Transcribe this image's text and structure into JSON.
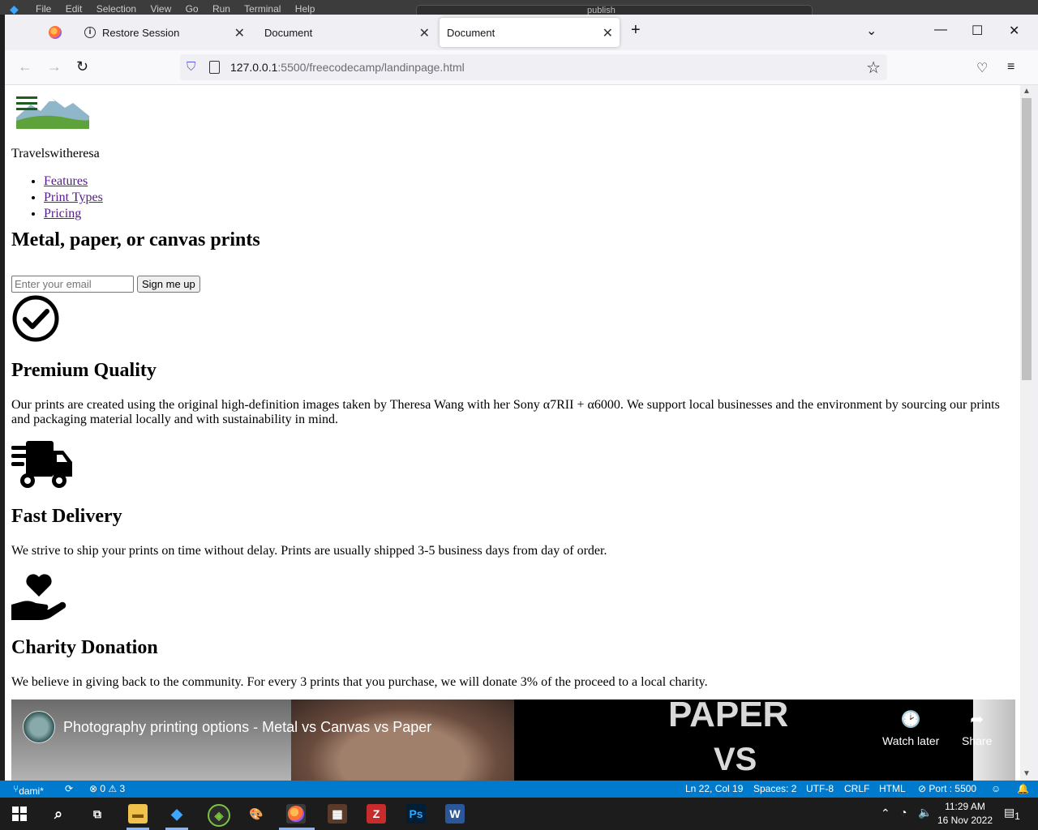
{
  "vscode": {
    "menu": [
      "File",
      "Edit",
      "Selection",
      "View",
      "Go",
      "Run",
      "Terminal",
      "Help"
    ],
    "command_center": "publish"
  },
  "browser": {
    "tabs": [
      {
        "label": "Restore Session",
        "active": false
      },
      {
        "label": "Document",
        "active": false
      },
      {
        "label": "Document",
        "active": true
      }
    ],
    "new_tab": "+",
    "url_host": "127.0.0.1",
    "url_rest": ":5500/freecodecamp/landinpage.html"
  },
  "page": {
    "brand": "Travelswitheresa",
    "nav": [
      "Features",
      "Print Types",
      "Pricing"
    ],
    "hero_title": "Metal, paper, or canvas prints",
    "email_placeholder": "Enter your email",
    "signup_label": "Sign me up",
    "features": [
      {
        "icon": "check-circle-icon",
        "title": "Premium Quality",
        "text": "Our prints are created using the original high-definition images taken by Theresa Wang with her Sony α7RII + α6000. We support local businesses and the environment by sourcing our prints and packaging material locally and with sustainability in mind."
      },
      {
        "icon": "truck-icon",
        "title": "Fast Delivery",
        "text": "We strive to ship your prints on time without delay. Prints are usually shipped 3-5 business days from day of order."
      },
      {
        "icon": "hand-heart-icon",
        "title": "Charity Donation",
        "text": "We believe in giving back to the community. For every 3 prints that you purchase, we will donate 3% of the proceed to a local charity."
      }
    ],
    "video": {
      "title": "Photography printing options - Metal vs Canvas vs Paper",
      "overlay_1": "PAPER",
      "overlay_2": "VS",
      "watch_later": "Watch later",
      "share": "Share"
    }
  },
  "statusbar": {
    "branch": "dami*",
    "problems": "⊗ 0 ⚠ 3",
    "position": "Ln 22, Col 19",
    "spaces": "Spaces: 2",
    "encoding": "UTF-8",
    "eol": "CRLF",
    "language": "HTML",
    "port": "⊘ Port : 5500"
  },
  "taskbar": {
    "time": "11:29 AM",
    "date": "16 Nov 2022",
    "notifications": "1"
  }
}
